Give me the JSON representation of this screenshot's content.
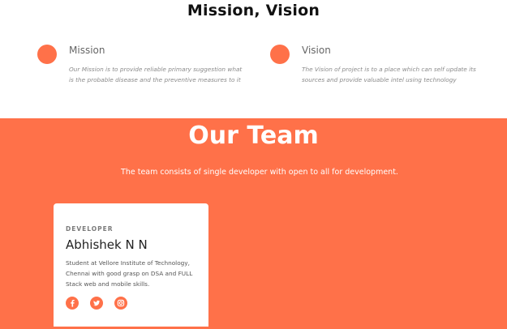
{
  "mission_vision": {
    "title": "Mission, Vision",
    "mission": {
      "heading": "Mission",
      "text": "Our Mission is to provide reliable primary suggestion what is the probable disease and the preventive measures to it",
      "icon": "orange-circle-icon"
    },
    "vision": {
      "heading": "Vision",
      "text": "The Vision of project is to a place which can self update its sources and provide valuable intel using technology",
      "icon": "orange-circle-icon"
    }
  },
  "team": {
    "title": "Our Team",
    "subtitle": "The team consists of single developer with open to all for development.",
    "members": [
      {
        "role": "DEVELOPER",
        "name": "Abhishek N N",
        "bio": "Student at Vellore Institute of Technology, Chennai with good grasp on DSA and FULL Stack web and mobile skills.",
        "socials": [
          "facebook-icon",
          "twitter-icon",
          "instagram-icon"
        ]
      }
    ]
  },
  "colors": {
    "accent": "#ff7149",
    "white": "#ffffff",
    "heading_dark": "#111111",
    "muted_text": "#8a8a8a"
  }
}
